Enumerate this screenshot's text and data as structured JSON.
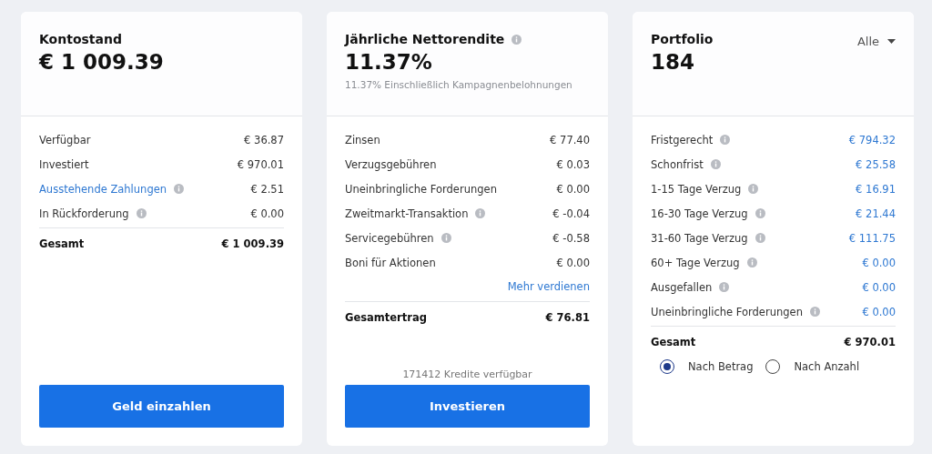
{
  "cards": [
    {
      "title": "Kontostand",
      "title_info": false,
      "amount": "€ 1 009.39",
      "rows": [
        {
          "label": "Verfügbar",
          "info": false,
          "link": false,
          "value": "€ 36.87",
          "value_link": false
        },
        {
          "label": "Investiert",
          "info": false,
          "link": false,
          "value": "€ 970.01",
          "value_link": false
        },
        {
          "label": "Ausstehende Zahlungen",
          "info": true,
          "link": true,
          "value": "€ 2.51",
          "value_link": false
        },
        {
          "label": "In Rückforderung",
          "info": true,
          "link": false,
          "value": "€ 0.00",
          "value_link": false
        }
      ],
      "total": {
        "label": "Gesamt",
        "value": "€ 1 009.39"
      },
      "button": "Geld einzahlen"
    },
    {
      "title": "Jährliche Nettorendite",
      "title_info": true,
      "amount": "11.37%",
      "subtitle": "11.37% Einschließlich Kampagnenbelohnungen",
      "rows": [
        {
          "label": "Zinsen",
          "info": false,
          "link": false,
          "value": "€ 77.40",
          "value_link": false
        },
        {
          "label": "Verzugsgebühren",
          "info": false,
          "link": false,
          "value": "€ 0.03",
          "value_link": false
        },
        {
          "label": "Uneinbringliche Forderungen",
          "info": false,
          "link": false,
          "value": "€ 0.00",
          "value_link": false
        },
        {
          "label": "Zweitmarkt-Transaktion",
          "info": true,
          "link": false,
          "value": "€ -0.04",
          "value_link": false
        },
        {
          "label": "Servicegebühren",
          "info": true,
          "link": false,
          "value": "€ -0.58",
          "value_link": false
        },
        {
          "label": "Boni für Aktionen",
          "info": false,
          "link": false,
          "value": "€ 0.00",
          "value_link": false
        }
      ],
      "more_link": "Mehr verdienen",
      "total": {
        "label": "Gesamtertrag",
        "value": "€ 76.81"
      },
      "footer_note": "171412 Kredite verfügbar",
      "button": "Investieren"
    },
    {
      "title": "Portfolio",
      "title_info": false,
      "amount": "184",
      "dropdown": "Alle",
      "rows": [
        {
          "label": "Fristgerecht",
          "info": true,
          "link": false,
          "value": "€ 794.32",
          "value_link": true
        },
        {
          "label": "Schonfrist",
          "info": true,
          "link": false,
          "value": "€ 25.58",
          "value_link": true
        },
        {
          "label": "1-15 Tage Verzug",
          "info": true,
          "link": false,
          "value": "€ 16.91",
          "value_link": true
        },
        {
          "label": "16-30 Tage Verzug",
          "info": true,
          "link": false,
          "value": "€ 21.44",
          "value_link": true
        },
        {
          "label": "31-60 Tage Verzug",
          "info": true,
          "link": false,
          "value": "€ 111.75",
          "value_link": true
        },
        {
          "label": "60+ Tage Verzug",
          "info": true,
          "link": false,
          "value": "€ 0.00",
          "value_link": true
        },
        {
          "label": "Ausgefallen",
          "info": true,
          "link": false,
          "value": "€ 0.00",
          "value_link": true
        },
        {
          "label": "Uneinbringliche Forderungen",
          "info": true,
          "link": false,
          "value": "€ 0.00",
          "value_link": true
        }
      ],
      "total": {
        "label": "Gesamt",
        "value": "€ 970.01"
      },
      "radios": [
        {
          "label": "Nach Betrag",
          "selected": true
        },
        {
          "label": "Nach Anzahl",
          "selected": false
        }
      ]
    }
  ]
}
